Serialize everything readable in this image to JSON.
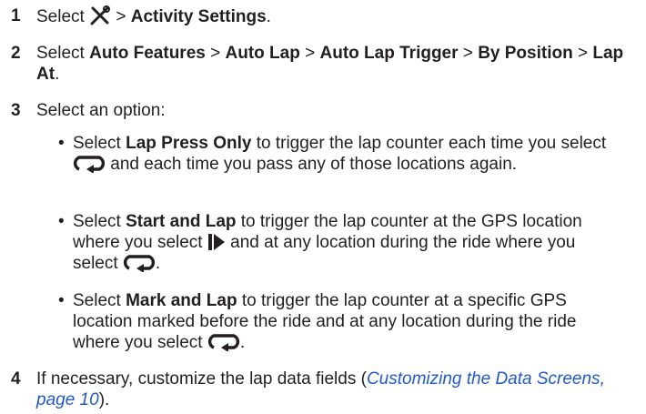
{
  "steps": [
    {
      "number": "1",
      "select": "Select",
      "icon": "wrench-screwdriver-icon",
      "sep": ">",
      "activity_settings": "Activity Settings",
      "end": "."
    },
    {
      "number": "2",
      "select": "Select",
      "auto_features": "Auto Features",
      "auto_lap": "Auto Lap",
      "auto_lap_trigger": "Auto Lap Trigger",
      "by_position": "By Position",
      "lap_at": "Lap At",
      "sep": ">",
      "end": "."
    },
    {
      "number": "3",
      "text": "Select an option:"
    },
    {
      "number": "4",
      "text_before": "If necessary, customize the lap data fields (",
      "link": "Customizing the Data Screens",
      "page_ref": ", page 10",
      "text_after": ")."
    }
  ],
  "options": [
    {
      "bullet": "•",
      "select": "Select",
      "name": "Lap Press Only",
      "text1": "to trigger the lap counter each time you select",
      "icon": "lap-loop-icon",
      "text2": "and each time you pass any of those locations again."
    },
    {
      "bullet": "•",
      "select": "Select",
      "name": "Start and Lap",
      "text1": "to trigger the lap counter at the GPS location where you select",
      "icon1": "start-play-icon",
      "text2": "and at any location during the ride where you select",
      "icon2": "lap-loop-icon",
      "end": "."
    },
    {
      "bullet": "•",
      "select": "Select",
      "name": "Mark and Lap",
      "text1": "to trigger the lap counter at a specific GPS location marked before the ride and at any location during the ride where you select",
      "icon": "lap-loop-icon",
      "end": "."
    }
  ]
}
